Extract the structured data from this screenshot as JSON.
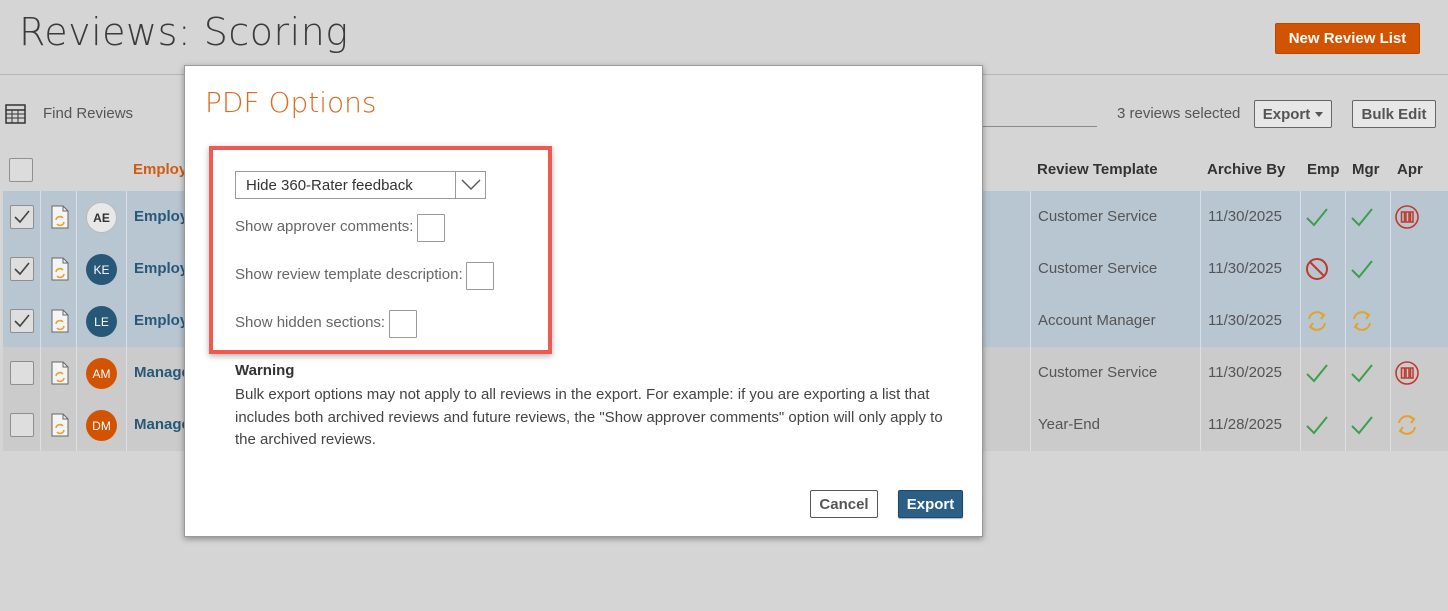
{
  "page": {
    "title": "Reviews: Scoring",
    "new_list_label": "New Review List"
  },
  "toolbar": {
    "find_label": "Find Reviews",
    "selected_count": "3 reviews selected",
    "export_label": "Export",
    "bulk_edit_label": "Bulk Edit"
  },
  "table": {
    "headers": {
      "employee": "Employ",
      "template": "Review Template",
      "archive_by": "Archive By",
      "emp": "Emp",
      "mgr": "Mgr",
      "apr": "Apr"
    },
    "rows": [
      {
        "checked": true,
        "initials": "AE",
        "avatar_color": "#e8e8e8",
        "avatar_text": "#333333",
        "name": "Employ",
        "template": "Customer Service",
        "archive_by": "11/30/2025",
        "emp": "check",
        "mgr": "check",
        "apr": "pause"
      },
      {
        "checked": true,
        "initials": "KE",
        "avatar_color": "#275878",
        "avatar_text": "#ffffff",
        "name": "Employ",
        "template": "Customer Service",
        "archive_by": "11/30/2025",
        "emp": "blocked",
        "mgr": "check",
        "apr": ""
      },
      {
        "checked": true,
        "initials": "LE",
        "avatar_color": "#275878",
        "avatar_text": "#ffffff",
        "name": "Employ",
        "template": "Account Manager",
        "archive_by": "11/30/2025",
        "emp": "cycle",
        "mgr": "cycle",
        "apr": ""
      },
      {
        "checked": false,
        "initials": "AM",
        "avatar_color": "#d35400",
        "avatar_text": "#ffffff",
        "name": "Manage",
        "template": "Customer Service",
        "archive_by": "11/30/2025",
        "emp": "check",
        "mgr": "check",
        "apr": "pause"
      },
      {
        "checked": false,
        "initials": "DM",
        "avatar_color": "#d35400",
        "avatar_text": "#ffffff",
        "name": "Manage",
        "template": "Year-End",
        "archive_by": "11/28/2025",
        "emp": "check",
        "mgr": "check",
        "apr": "cycle"
      }
    ]
  },
  "modal": {
    "title": "PDF Options",
    "feedback_select": {
      "value": "Hide 360-Rater feedback"
    },
    "options": [
      {
        "label": "Show approver comments:",
        "checked": false
      },
      {
        "label": "Show review template description:",
        "checked": false
      },
      {
        "label": "Show hidden sections:",
        "checked": false
      }
    ],
    "warning_title": "Warning",
    "warning_text": "Bulk export options may not apply to all reviews in the export. For example: if you are exporting a list that includes both archived reviews and future reviews, the \"Show approver comments\" option will only apply to the archived reviews.",
    "cancel_label": "Cancel",
    "export_label": "Export"
  },
  "colors": {
    "accent_orange": "#d35400",
    "primary_blue": "#2b5f85",
    "status_green": "#3aa14a",
    "status_red": "#c0392b",
    "status_amber": "#e5a22b",
    "highlight_red": "#ee5a52"
  }
}
